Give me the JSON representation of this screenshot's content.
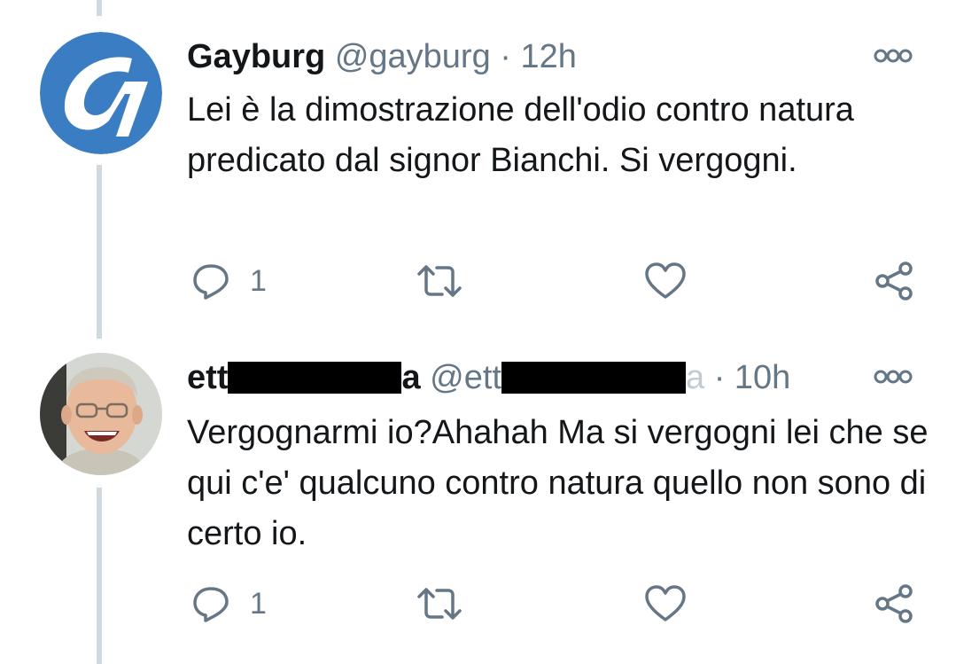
{
  "tweets": [
    {
      "display_name": "Gayburg",
      "handle": "@gayburg",
      "dot": "·",
      "time": "12h",
      "text": "Lei è la dimostrazione dell'odio contro natura predicato dal signor Bianchi. Si vergogni.",
      "reply_count": "1",
      "avatar_icon": "gayburg-logo-icon"
    },
    {
      "display_name_prefix": "ett",
      "display_name_suffix": "a",
      "handle_prefix": "@ett",
      "handle_suffix": "a",
      "dot": "·",
      "time": "10h",
      "text": "Vergognarmi io?Ahahah Ma si vergogni lei che se qui c'e' qualcuno contro natura quello non sono di certo io.",
      "reply_count": "1",
      "avatar_icon": "user-photo"
    }
  ],
  "icons": {
    "reply": "reply-icon",
    "retweet": "retweet-icon",
    "like": "heart-icon",
    "share": "share-icon",
    "more": "more-options-icon"
  },
  "colors": {
    "text": "#14171a",
    "secondary": "#657786",
    "thread_line": "#cfd9de",
    "brand_blue": "#3a7dc2",
    "redaction": "#000000"
  }
}
